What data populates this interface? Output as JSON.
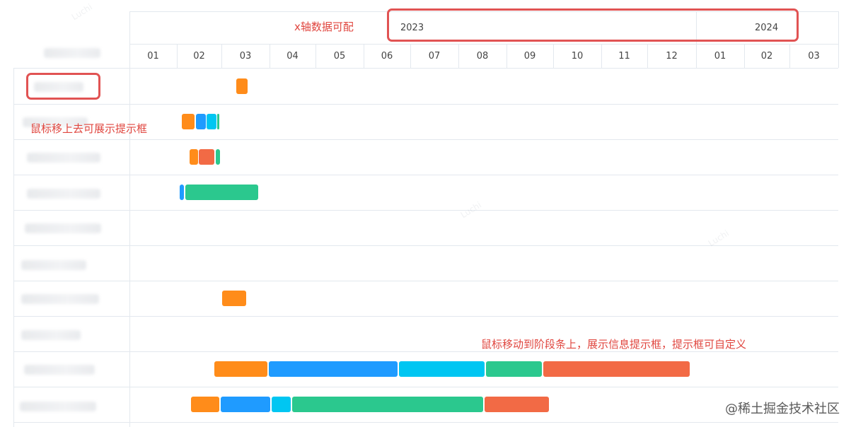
{
  "gantt": {
    "years": [
      {
        "label": "2023"
      },
      {
        "label": "2024"
      }
    ],
    "months": [
      "01",
      "02",
      "03",
      "04",
      "05",
      "06",
      "07",
      "08",
      "09",
      "10",
      "11",
      "12",
      "01",
      "02",
      "03"
    ],
    "rows": [
      {
        "bars": [
          {
            "color": "#ff8c1a"
          }
        ]
      },
      {
        "bars": [
          {
            "color": "#ff8c1a"
          },
          {
            "color": "#1f9bff"
          },
          {
            "color": "#00c6f2"
          },
          {
            "color": "#2bc88e"
          }
        ]
      },
      {
        "bars": [
          {
            "color": "#ff8c1a"
          },
          {
            "color": "#f26a45"
          },
          {
            "color": "#2bc88e"
          }
        ]
      },
      {
        "bars": [
          {
            "color": "#1f9bff"
          },
          {
            "color": "#2bc88e"
          }
        ]
      },
      {
        "bars": []
      },
      {
        "bars": []
      },
      {
        "bars": [
          {
            "color": "#ff8c1a"
          }
        ]
      },
      {
        "bars": []
      },
      {
        "bars": [
          {
            "color": "#ff8c1a"
          },
          {
            "color": "#1f9bff"
          },
          {
            "color": "#00c6f2"
          },
          {
            "color": "#2bc88e"
          },
          {
            "color": "#f26a45"
          }
        ]
      },
      {
        "bars": [
          {
            "color": "#ff8c1a"
          },
          {
            "color": "#1f9bff"
          },
          {
            "color": "#00c6f2"
          },
          {
            "color": "#2bc88e"
          },
          {
            "color": "#f26a45"
          }
        ]
      }
    ]
  },
  "annotations": {
    "xaxis_note": "x轴数据可配",
    "hover_row_note": "鼠标移上去可展示提示框",
    "hover_bar_note": "鼠标移动到阶段条上，展示信息提示框，提示框可自定义"
  },
  "watermark": {
    "text": "@稀土掘金技术社区"
  }
}
